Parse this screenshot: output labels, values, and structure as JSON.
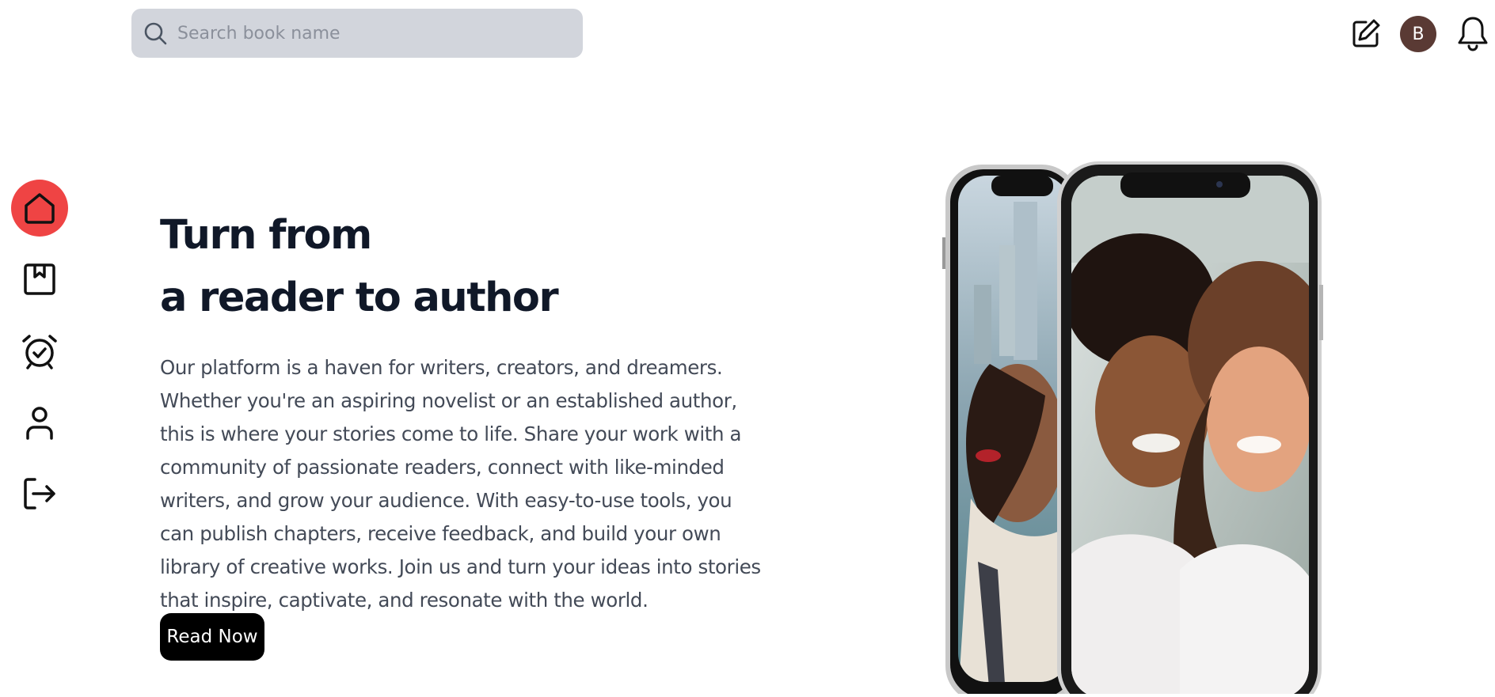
{
  "search": {
    "placeholder": "Search book name"
  },
  "header": {
    "avatar_initial": "B"
  },
  "hero": {
    "title_line1": "Turn from",
    "title_line2": "a reader to author",
    "description": "Our platform is a haven for writers, creators, and dreamers. Whether you're an aspiring novelist or an established author, this is where your stories come to life. Share your work with a community of passionate readers, connect with like-minded writers, and grow your audience. With easy-to-use tools, you can publish chapters, receive feedback, and build your own library of creative works. Join us and turn your ideas into stories that inspire, captivate, and resonate with the world.",
    "cta_label": "Read Now"
  },
  "sidebar": {
    "items": [
      {
        "icon": "home-icon",
        "active": true
      },
      {
        "icon": "bookmark-book-icon",
        "active": false
      },
      {
        "icon": "alarm-check-icon",
        "active": false
      },
      {
        "icon": "user-icon",
        "active": false
      },
      {
        "icon": "logout-icon",
        "active": false
      }
    ]
  },
  "colors": {
    "accent": "#ef4444",
    "search_bg": "#d2d5dc",
    "avatar_bg": "#5a3a34",
    "button_bg": "#000000",
    "heading": "#101828",
    "body_text": "#434a57"
  }
}
